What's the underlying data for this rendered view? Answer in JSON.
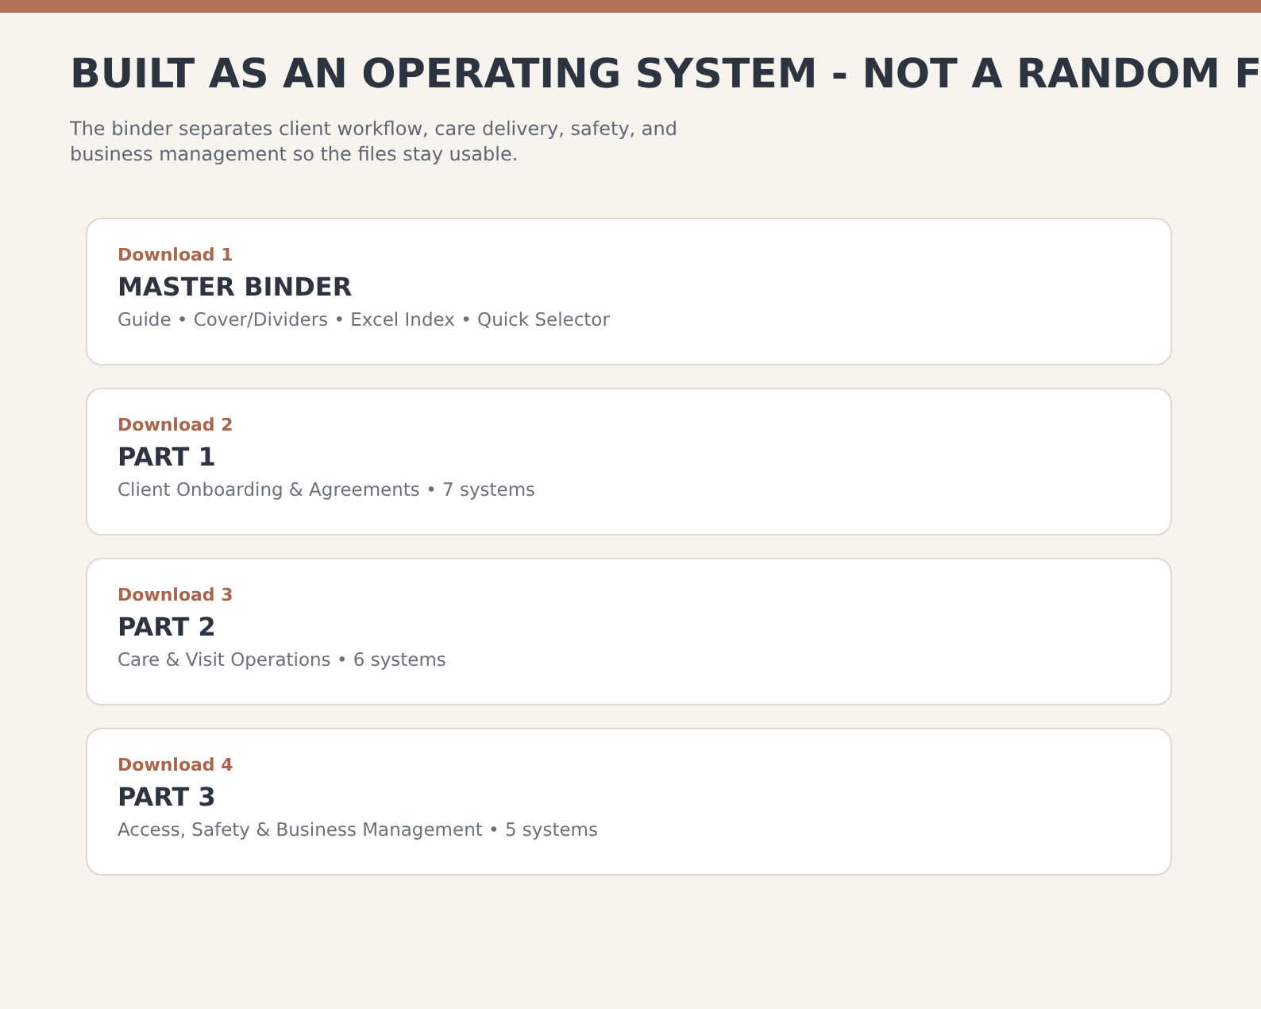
{
  "heading": "BUILT AS AN OPERATING SYSTEM - NOT A RANDOM F",
  "intro": "The binder separates client workflow, care delivery, safety, and business management so the files stay usable.",
  "downloads": [
    {
      "label": "Download 1",
      "title": "MASTER BINDER",
      "description": "Guide • Cover/Dividers • Excel Index • Quick Selector"
    },
    {
      "label": "Download 2",
      "title": "PART 1",
      "description": "Client Onboarding & Agreements • 7 systems"
    },
    {
      "label": "Download 3",
      "title": "PART 2",
      "description": "Care & Visit Operations • 6 systems"
    },
    {
      "label": "Download 4",
      "title": "PART 3",
      "description": "Access, Safety & Business Management • 5 systems"
    }
  ]
}
